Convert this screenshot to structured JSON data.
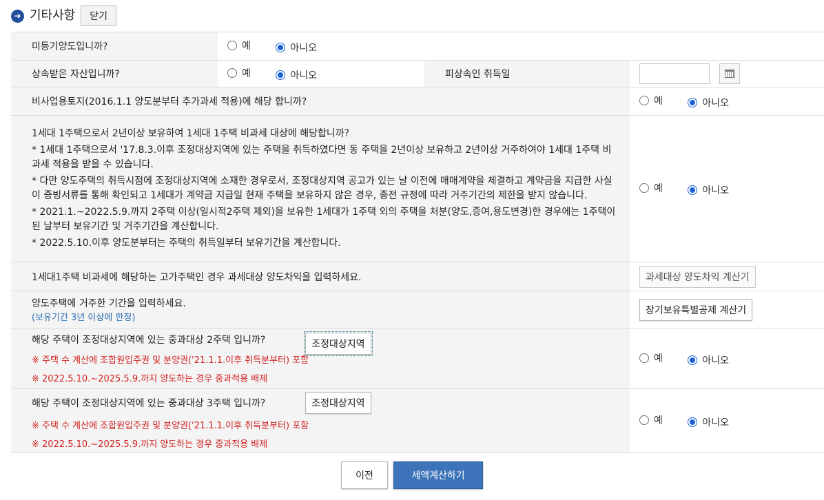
{
  "header": {
    "icon": "arrow-right-circle-icon",
    "title": "기타사항",
    "close_label": "닫기"
  },
  "radio_labels": {
    "yes": "예",
    "no": "아니오"
  },
  "rows": {
    "unregistered": {
      "question": "미등기양도입니까?",
      "selected": "no"
    },
    "inherited": {
      "question": "상속받은 자산입니까?",
      "selected": "no",
      "date_label": "피상속인 취득일",
      "date_value": ""
    },
    "non_business_land": {
      "question": "비사업용토지(2016.1.1 양도분부터 추가과세 적용)에 해당 합니까?",
      "selected": "no"
    },
    "one_house": {
      "question": "1세대 1주택으로서 2년이상 보유하여 1세대 1주택 비과세 대상에 해당합니까?",
      "notes": [
        "* 1세대 1주택으로서 '17.8.3.이후 조정대상지역에 있는 주택을 취득하였다면 동 주택을 2년이상 보유하고 2년이상 거주하여야 1세대 1주택 비과세 적용을 받을 수 있습니다.",
        "* 다만 양도주택의 취득시점에 조정대상지역에 소재한 경우로서, 조정대상지역 공고가 있는 날 이전에 매매계약을 체결하고 계약금을 지급한 사실이 증빙서류를 통해 확인되고 1세대가 계약금 지급일 현재 주택을 보유하지 않은 경우, 종전 규정에 따라 거주기간의 제한을 받지 않습니다.",
        "* 2021.1.~2022.5.9.까지 2주택 이상(일시적2주택 제외)을 보유한 1세대가 1주택 외의 주택을 처분(양도,증여,용도변경)한 경우에는 1주택이 된 날부터 보유기간 및 거주기간을 계산합니다.",
        "* 2022.5.10.이후 양도분부터는 주택의 취득일부터 보유기간을 계산합니다."
      ],
      "selected": "no"
    },
    "luxury_house": {
      "question": "1세대1주택 비과세에 해당하는 고가주택인 경우 과세대상 양도차익을 입력하세요.",
      "button_label": "과세대상 양도차익 계산기"
    },
    "residence": {
      "question": "양도주택에 거주한 기간을 입력하세요.",
      "note": "(보유기간 3년 이상에 한정)",
      "button_label": "장기보유특별공제 계산기"
    },
    "two_house": {
      "question": "해당 주택이 조정대상지역에 있는 중과대상 2주택 입니까?",
      "button_label": "조정대상지역",
      "note1": "※ 주택 수 계산에 조합원입주권 및 분양권('21.1.1.이후 취득분부터) 포함",
      "note2": "※ 2022.5.10.~2025.5.9.까지 양도하는 경우 중과적용 배제",
      "selected": "no"
    },
    "three_house": {
      "question": "해당 주택이 조정대상지역에 있는 중과대상 3주택 입니까?",
      "button_label": "조정대상지역",
      "note1": "※ 주택 수 계산에 조합원입주권 및 분양권('21.1.1.이후 취득분부터) 포함",
      "note2": "※ 2022.5.10.~2025.5.9.까지 양도하는 경우 중과적용 배제",
      "selected": "no"
    }
  },
  "footer": {
    "prev_label": "이전",
    "calc_label": "세액계산하기"
  },
  "colors": {
    "accent_blue": "#3d73b9",
    "note_red": "#d21f1f",
    "note_blue": "#2d6db5",
    "label_bg": "#f4f4f4"
  }
}
